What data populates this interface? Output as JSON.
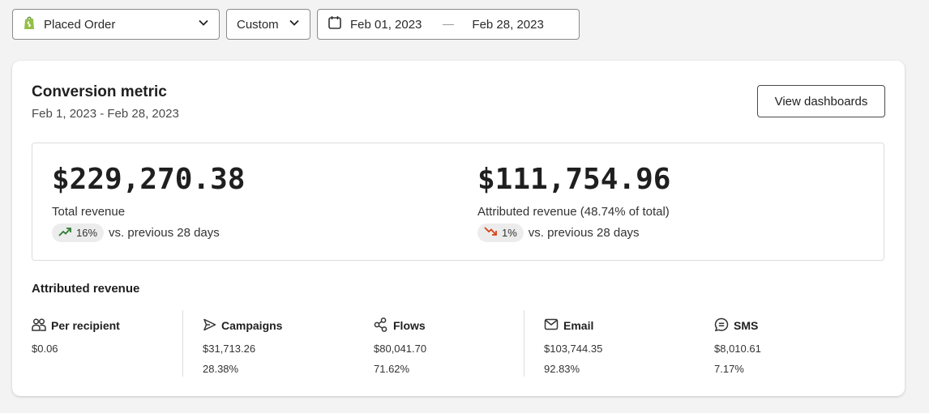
{
  "filters": {
    "metric": "Placed Order",
    "range": "Custom",
    "start_date": "Feb 01, 2023",
    "end_date": "Feb 28, 2023"
  },
  "card": {
    "title": "Conversion metric",
    "subtitle": "Feb 1, 2023 - Feb 28, 2023",
    "button": "View dashboards"
  },
  "summary": {
    "total": {
      "value": "$229,270.38",
      "label": "Total revenue",
      "change": "16%",
      "direction": "up",
      "comparison": "vs. previous 28 days"
    },
    "attributed": {
      "value": "$111,754.96",
      "label": "Attributed revenue (48.74% of total)",
      "change": "1%",
      "direction": "down",
      "comparison": "vs. previous 28 days"
    }
  },
  "attributed_section": {
    "title": "Attributed revenue",
    "columns": [
      {
        "label": "Per recipient",
        "icon": "people-icon",
        "value": "$0.06",
        "pct": ""
      },
      {
        "label": "Campaigns",
        "icon": "send-icon",
        "value": "$31,713.26",
        "pct": "28.38%"
      },
      {
        "label": "Flows",
        "icon": "flow-icon",
        "value": "$80,041.70",
        "pct": "71.62%"
      },
      {
        "label": "Email",
        "icon": "mail-icon",
        "value": "$103,744.35",
        "pct": "92.83%"
      },
      {
        "label": "SMS",
        "icon": "sms-icon",
        "value": "$8,010.61",
        "pct": "7.17%"
      }
    ]
  },
  "colors": {
    "up": "#2e7d32",
    "down": "#d84315",
    "border": "#8a8a8a"
  }
}
